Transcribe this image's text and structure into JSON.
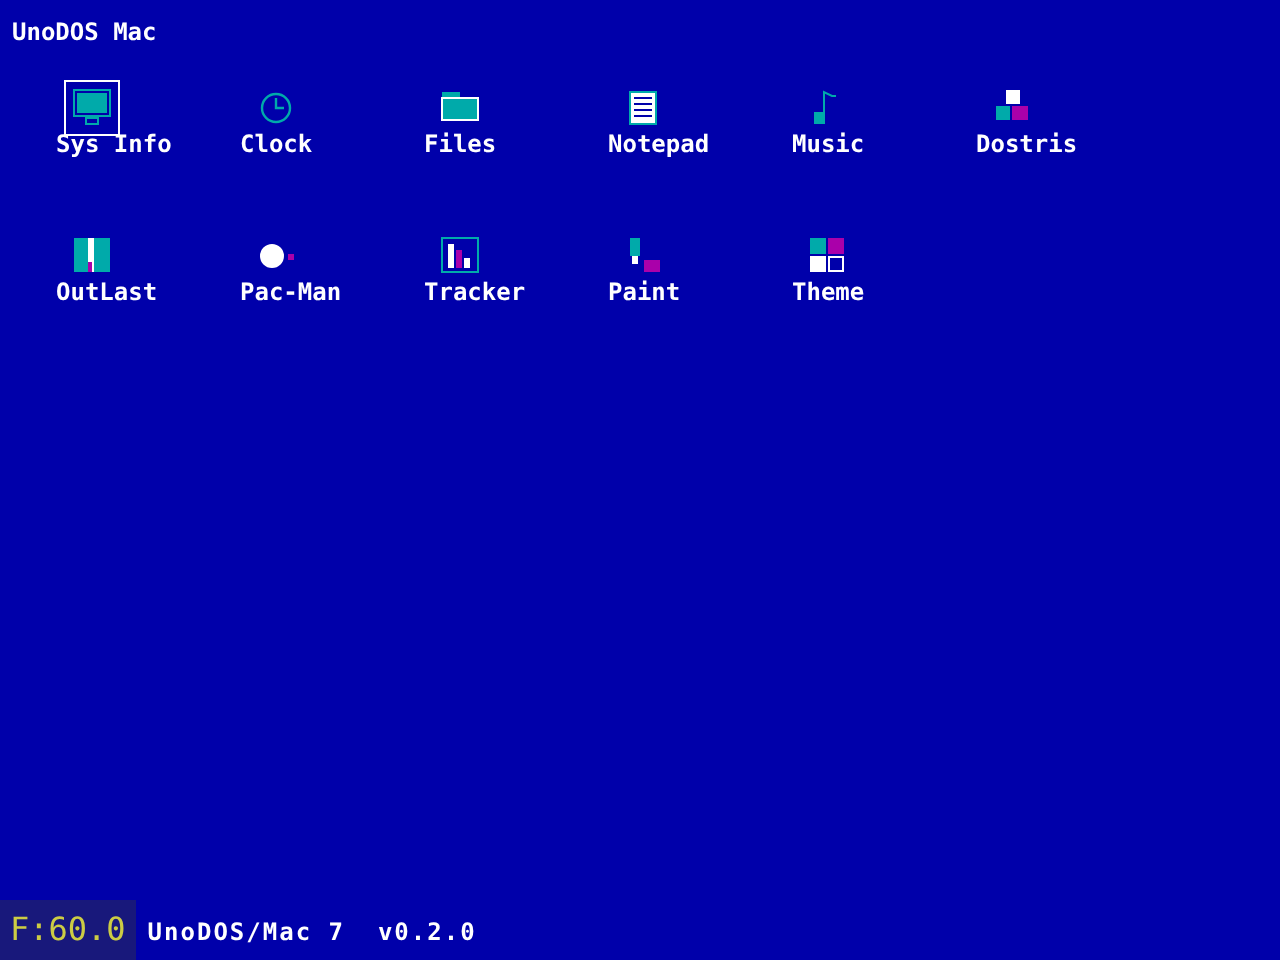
{
  "menu_bar": {
    "title": "UnoDOS Mac"
  },
  "desktop_icons": [
    {
      "label": "Sys Info",
      "kind": "monitor",
      "selected": true
    },
    {
      "label": "Clock",
      "kind": "clock",
      "selected": false
    },
    {
      "label": "Files",
      "kind": "folder",
      "selected": false
    },
    {
      "label": "Notepad",
      "kind": "notepad",
      "selected": false
    },
    {
      "label": "Music",
      "kind": "music",
      "selected": false
    },
    {
      "label": "Dostris",
      "kind": "blocks",
      "selected": false
    },
    {
      "label": "OutLast",
      "kind": "road",
      "selected": false
    },
    {
      "label": "Pac-Man",
      "kind": "pacman",
      "selected": false
    },
    {
      "label": "Tracker",
      "kind": "bars",
      "selected": false
    },
    {
      "label": "Paint",
      "kind": "paint",
      "selected": false
    },
    {
      "label": "Theme",
      "kind": "palette",
      "selected": false
    }
  ],
  "footer": {
    "version": "UnoDOS/Mac 7  v0.2.0"
  },
  "fps_overlay": {
    "text": "F:60.0"
  }
}
